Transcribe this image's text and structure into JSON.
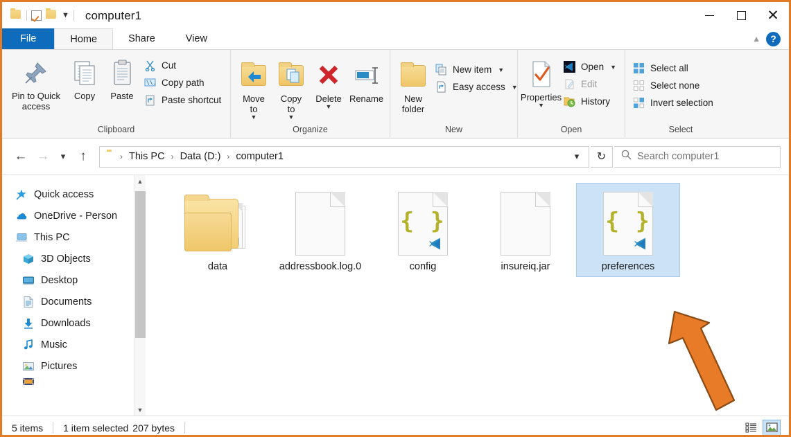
{
  "window": {
    "title": "computer1",
    "minimize_label": "Minimize",
    "maximize_label": "Maximize",
    "close_label": "Close",
    "accent_blue": "#0F6CBD",
    "selection_blue": "#cce3f7",
    "annotation_orange": "#E87B28"
  },
  "quick_access_toolbar": {
    "folder_label": "Explorer",
    "properties_label": "Properties",
    "new_folder_label": "New folder",
    "customize_label": "Customize Quick Access Toolbar"
  },
  "tabs": [
    {
      "label": "File",
      "kind": "file"
    },
    {
      "label": "Home",
      "kind": "active"
    },
    {
      "label": "Share",
      "kind": "normal"
    },
    {
      "label": "View",
      "kind": "normal"
    }
  ],
  "tab_right": {
    "collapse_label": "Minimize the Ribbon",
    "help_label": "?"
  },
  "ribbon": {
    "groups": [
      {
        "name": "Clipboard",
        "big_buttons": [
          {
            "label": "Pin to Quick access",
            "icon": "pin-icon"
          },
          {
            "label": "Copy",
            "icon": "copy-icon"
          },
          {
            "label": "Paste",
            "icon": "paste-icon"
          }
        ],
        "small_buttons": [
          {
            "label": "Cut",
            "icon": "scissors-icon",
            "disabled": false
          },
          {
            "label": "Copy path",
            "icon": "copy-path-icon",
            "disabled": false
          },
          {
            "label": "Paste shortcut",
            "icon": "paste-shortcut-icon",
            "disabled": false
          }
        ]
      },
      {
        "name": "Organize",
        "big_buttons": [
          {
            "label": "Move to",
            "icon": "move-to-icon",
            "dropdown": true
          },
          {
            "label": "Copy to",
            "icon": "copy-to-icon",
            "dropdown": true
          },
          {
            "label": "Delete",
            "icon": "delete-icon",
            "dropdown": true
          },
          {
            "label": "Rename",
            "icon": "rename-icon",
            "dropdown": false
          }
        ],
        "small_buttons": []
      },
      {
        "name": "New",
        "big_buttons": [
          {
            "label": "New folder",
            "icon": "new-folder-icon"
          }
        ],
        "small_buttons": [
          {
            "label": "New item",
            "icon": "new-item-icon",
            "dropdown": true
          },
          {
            "label": "Easy access",
            "icon": "easy-access-icon",
            "dropdown": true
          }
        ]
      },
      {
        "name": "Open",
        "big_buttons": [
          {
            "label": "Properties",
            "icon": "properties-icon",
            "dropdown": true
          }
        ],
        "small_buttons": [
          {
            "label": "Open",
            "icon": "vscode-icon",
            "dropdown": true,
            "disabled": false
          },
          {
            "label": "Edit",
            "icon": "edit-icon",
            "disabled": true
          },
          {
            "label": "History",
            "icon": "history-icon",
            "disabled": false
          }
        ]
      },
      {
        "name": "Select",
        "big_buttons": [],
        "small_buttons": [
          {
            "label": "Select all",
            "icon": "select-all-icon",
            "disabled": false
          },
          {
            "label": "Select none",
            "icon": "select-none-icon",
            "disabled": false
          },
          {
            "label": "Invert selection",
            "icon": "invert-selection-icon",
            "disabled": false
          }
        ]
      }
    ]
  },
  "address_bar": {
    "back_label": "Back",
    "forward_label": "Forward",
    "recent_label": "Recent locations",
    "up_label": "Up",
    "breadcrumbs": [
      "This PC",
      "Data (D:)",
      "computer1"
    ],
    "separator": "›",
    "dropdown_label": "Previous locations",
    "refresh_label": "Refresh",
    "search_placeholder": "Search computer1",
    "search_value": ""
  },
  "sidebar": {
    "items": [
      {
        "label": "Quick access",
        "icon": "star-pin-icon",
        "indent": false
      },
      {
        "label": "OneDrive - Person",
        "icon": "onedrive-cloud-icon",
        "indent": false
      },
      {
        "label": "This PC",
        "icon": "this-pc-icon",
        "indent": false
      },
      {
        "label": "3D Objects",
        "icon": "3d-objects-icon",
        "indent": true
      },
      {
        "label": "Desktop",
        "icon": "desktop-icon",
        "indent": true
      },
      {
        "label": "Documents",
        "icon": "documents-icon",
        "indent": true
      },
      {
        "label": "Downloads",
        "icon": "downloads-icon",
        "indent": true
      },
      {
        "label": "Music",
        "icon": "music-icon",
        "indent": true
      },
      {
        "label": "Pictures",
        "icon": "pictures-icon",
        "indent": true
      },
      {
        "label": "",
        "icon": "videos-icon",
        "indent": true
      }
    ],
    "scroll_up_label": "Scroll up",
    "scroll_down_label": "Scroll down"
  },
  "content": {
    "files": [
      {
        "name": "data",
        "icon": "folder-with-json-icon",
        "selected": false
      },
      {
        "name": "addressbook.log.0",
        "icon": "blank-document-icon",
        "selected": false
      },
      {
        "name": "config",
        "icon": "json-vscode-icon",
        "selected": false
      },
      {
        "name": "insureiq.jar",
        "icon": "blank-document-icon",
        "selected": false
      },
      {
        "name": "preferences",
        "icon": "json-vscode-icon",
        "selected": true
      }
    ]
  },
  "annotation": {
    "type": "arrow",
    "points_to": "preferences",
    "direction": "up-left",
    "color": "#E87B28"
  },
  "status_bar": {
    "item_count": "5 items",
    "selection_info": "1 item selected",
    "selection_size": "207 bytes",
    "details_view_label": "Details view",
    "large_icons_view_label": "Large icons view",
    "active_view": "large-icons"
  }
}
